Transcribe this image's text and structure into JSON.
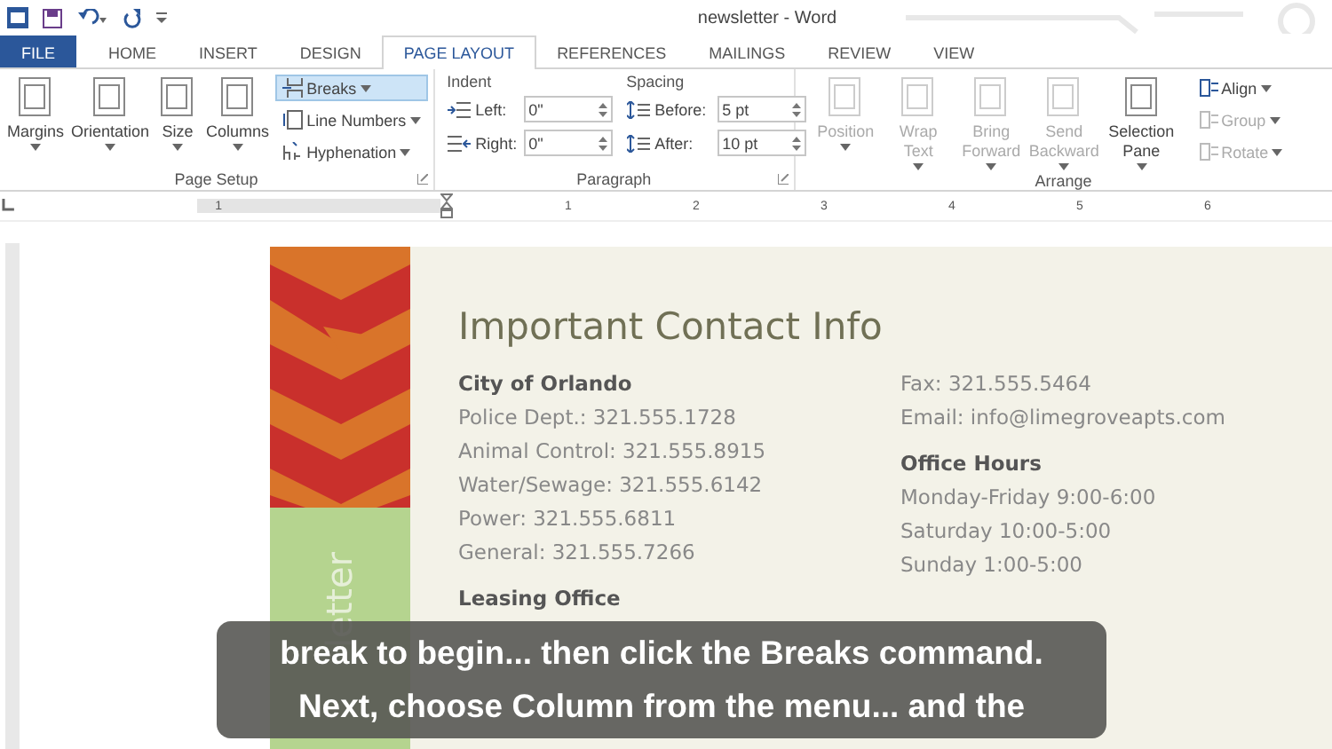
{
  "window": {
    "title": "newsletter - Word"
  },
  "tabs": [
    {
      "label": "FILE",
      "kind": "file",
      "selected": false
    },
    {
      "label": "HOME",
      "kind": "tab",
      "selected": false
    },
    {
      "label": "INSERT",
      "kind": "tab",
      "selected": false
    },
    {
      "label": "DESIGN",
      "kind": "tab",
      "selected": false
    },
    {
      "label": "PAGE LAYOUT",
      "kind": "tab",
      "selected": true
    },
    {
      "label": "REFERENCES",
      "kind": "tab",
      "selected": false
    },
    {
      "label": "MAILINGS",
      "kind": "tab",
      "selected": false
    },
    {
      "label": "REVIEW",
      "kind": "tab",
      "selected": false
    },
    {
      "label": "VIEW",
      "kind": "tab",
      "selected": false
    }
  ],
  "page_setup": {
    "label": "Page Setup",
    "large_buttons": [
      {
        "label": "Margins",
        "disabled": false
      },
      {
        "label": "Orientation",
        "disabled": false
      },
      {
        "label": "Size",
        "disabled": false
      },
      {
        "label": "Columns",
        "disabled": false
      }
    ],
    "small_buttons": [
      {
        "label": "Breaks",
        "selected": true
      },
      {
        "label": "Line Numbers",
        "selected": false
      },
      {
        "label": "Hyphenation",
        "selected": false
      }
    ]
  },
  "paragraph": {
    "label": "Paragraph",
    "indent": {
      "label": "Indent",
      "fields": [
        {
          "label": "Left:",
          "value": "0\""
        },
        {
          "label": "Right:",
          "value": "0\""
        }
      ]
    },
    "spacing": {
      "label": "Spacing",
      "fields": [
        {
          "label": "Before:",
          "value": "5 pt"
        },
        {
          "label": "After:",
          "value": "10 pt"
        }
      ]
    }
  },
  "arrange": {
    "label": "Arrange",
    "large_buttons": [
      {
        "label": "Position",
        "disabled": true
      },
      {
        "label": "Wrap Text",
        "disabled": true
      },
      {
        "label": "Bring Forward",
        "disabled": true
      },
      {
        "label": "Send Backward",
        "disabled": true
      },
      {
        "label": "Selection Pane",
        "disabled": false
      }
    ],
    "small_buttons": [
      {
        "label": "Align",
        "disabled": false
      },
      {
        "label": "Group",
        "disabled": true
      },
      {
        "label": "Rotate",
        "disabled": true
      }
    ]
  },
  "ruler": {
    "numbers": [
      "1",
      "1",
      "2",
      "3",
      "4",
      "5",
      "6"
    ]
  },
  "document": {
    "heading": "Important Contact Info",
    "sidebar_text": "letter",
    "left_column": [
      {
        "kind": "heading",
        "text": "City of Orlando"
      },
      {
        "kind": "line",
        "text": "Police Dept.: 321.555.1728"
      },
      {
        "kind": "line",
        "text": "Animal Control: 321.555.8915"
      },
      {
        "kind": "line",
        "text": "Water/Sewage: 321.555.6142"
      },
      {
        "kind": "line",
        "text": "Power: 321.555.6811"
      },
      {
        "kind": "line",
        "text": "General: 321.555.7266"
      },
      {
        "kind": "heading",
        "text": "Leasing Office"
      }
    ],
    "right_column": [
      {
        "kind": "line",
        "text": "Fax: 321.555.5464"
      },
      {
        "kind": "line",
        "text": "Email: info@limegroveapts.com"
      },
      {
        "kind": "heading",
        "text": "Office Hours"
      },
      {
        "kind": "line",
        "text": "Monday-Friday 9:00-6:00"
      },
      {
        "kind": "line",
        "text": "Saturday 10:00-5:00"
      },
      {
        "kind": "line",
        "text": "Sunday 1:00-5:00"
      }
    ]
  },
  "caption": {
    "lines": [
      "break to begin... then click the Breaks command.",
      "Next, choose Column from the menu... and the"
    ]
  }
}
